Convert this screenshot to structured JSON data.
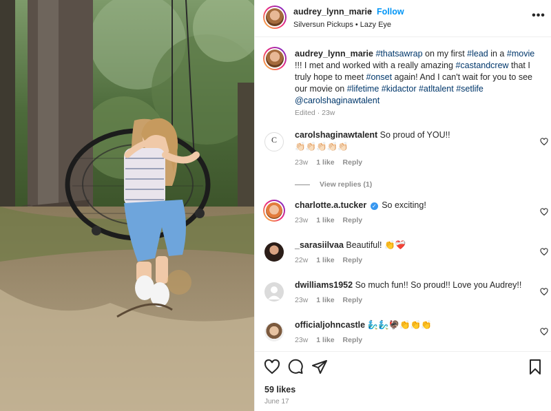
{
  "post": {
    "username": "audrey_lynn_marie",
    "separator": "•",
    "follow_label": "Follow",
    "audio": "Silversun Pickups • Lazy Eye",
    "more_label": "•••"
  },
  "caption": {
    "username": "audrey_lynn_marie",
    "segments": [
      {
        "text": "#thatsawrap",
        "tag": true
      },
      {
        "text": " on my first ",
        "tag": false
      },
      {
        "text": "#lead",
        "tag": true
      },
      {
        "text": " in a ",
        "tag": false
      },
      {
        "text": "#movie",
        "tag": true
      },
      {
        "text": " !!! I met and worked with a really amazing ",
        "tag": false
      },
      {
        "text": "#castandcrew",
        "tag": true
      },
      {
        "text": " that I truly hope to meet ",
        "tag": false
      },
      {
        "text": "#onset",
        "tag": true
      },
      {
        "text": " again! And I can't wait for you to see our movie on ",
        "tag": false
      },
      {
        "text": "#lifetime",
        "tag": true
      },
      {
        "text": "        ",
        "tag": false
      },
      {
        "text": "#kidactor",
        "tag": true
      },
      {
        "text": " ",
        "tag": false
      },
      {
        "text": "#atltalent",
        "tag": true
      },
      {
        "text": " ",
        "tag": false
      },
      {
        "text": "#setlife",
        "tag": true
      },
      {
        "text": " ",
        "tag": false
      },
      {
        "text": "@carolshaginawtalent",
        "tag": true
      }
    ],
    "meta": "Edited · 23w"
  },
  "comments": [
    {
      "username": "carolshaginawtalent",
      "text": "So proud of YOU!!",
      "emoji": "👏🏻👏🏻👏🏻👏🏻👏🏻",
      "time": "23w",
      "likes": "1 like",
      "reply": "Reply",
      "verified": false,
      "avatar": "logo"
    },
    {
      "username": "charlotte.a.tucker",
      "text": "So exciting!",
      "emoji": "",
      "time": "23w",
      "likes": "1 like",
      "reply": "Reply",
      "verified": true,
      "avatar": "ring"
    },
    {
      "username": "_sarasiilvaa",
      "text": "Beautiful!",
      "emoji": "👏❤️‍🩹",
      "time": "22w",
      "likes": "1 like",
      "reply": "Reply",
      "verified": false,
      "avatar": "photo"
    },
    {
      "username": "dwilliams1952",
      "text": "So much fun!! So proud!! Love you Audrey!!",
      "emoji": "",
      "time": "23w",
      "likes": "1 like",
      "reply": "Reply",
      "verified": false,
      "avatar": "default"
    },
    {
      "username": "officialjohncastle",
      "text": "",
      "emoji": "🧞‍♂️🧞‍♂️🦃👏👏👏",
      "time": "23w",
      "likes": "1 like",
      "reply": "Reply",
      "verified": false,
      "avatar": "photo2"
    }
  ],
  "view_replies": "View replies (1)",
  "footer": {
    "likes": "59 likes",
    "date": "June 17"
  },
  "icons": [
    "more-icon",
    "heart-icon",
    "comment-icon",
    "share-icon",
    "bookmark-icon"
  ],
  "colors": {
    "link": "#0095f6",
    "hashtag": "#00376b",
    "muted": "#8e8e8e",
    "verified": "#3797f0"
  }
}
